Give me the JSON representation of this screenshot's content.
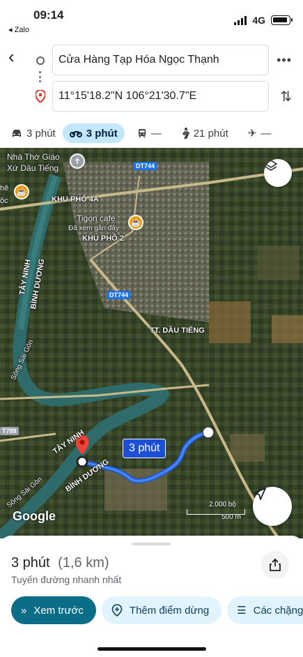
{
  "status": {
    "time": "09:14",
    "back_app": "◂ Zalo",
    "network": "4G"
  },
  "route": {
    "origin": "Cửa Hàng Tạp Hóa Ngọc Thạnh",
    "destination": "11°15'18.2\"N 106°21'30.7\"E"
  },
  "modes": [
    {
      "icon": "car-icon",
      "label": "3 phút"
    },
    {
      "icon": "motorbike-icon",
      "label": "3 phút"
    },
    {
      "icon": "transit-icon",
      "label": "—"
    },
    {
      "icon": "walk-icon",
      "label": "21 phút"
    },
    {
      "icon": "flight-icon",
      "label": "—"
    }
  ],
  "map": {
    "labels": {
      "church": "Nhà Thờ Giáo",
      "church2": "Xứ Dầu Tiếng",
      "khu_pho_4a": "KHU PHỐ 4A",
      "tigon": "Tigon cafe",
      "tigon_sub": "Đã xem gần đây",
      "khu_pho_2": "KHU PHỐ 2",
      "tay_ninh_1": "TÂY NINH",
      "binh_duong_1": "BÌNH DƯƠNG",
      "tt_dau_tieng": "TT. DẦU TIẾNG",
      "song_sai_gon_1": "Sông Sài Gòn",
      "tay_ninh_2": "TÂY NINH",
      "binh_duong_2": "BÌNH DƯƠNG",
      "song_sai_gon_2": "Sông Sài Gòn",
      "left_poi": "hê",
      "left_poi2": "ộc"
    },
    "roads": {
      "dt744_top": "DT744",
      "dt744_mid": "DT744",
      "t789": "T789"
    },
    "callout": "3 phút",
    "google": "Google",
    "scale_ft": "2.000 bộ",
    "scale_m": "500 m"
  },
  "sheet": {
    "duration": "3 phút",
    "distance": "(1,6 km)",
    "subtitle": "Tuyến đường nhanh nhất",
    "actions": {
      "preview": "Xem trước",
      "add_stop": "Thêm điểm dừng",
      "steps": "Các chặng"
    }
  }
}
